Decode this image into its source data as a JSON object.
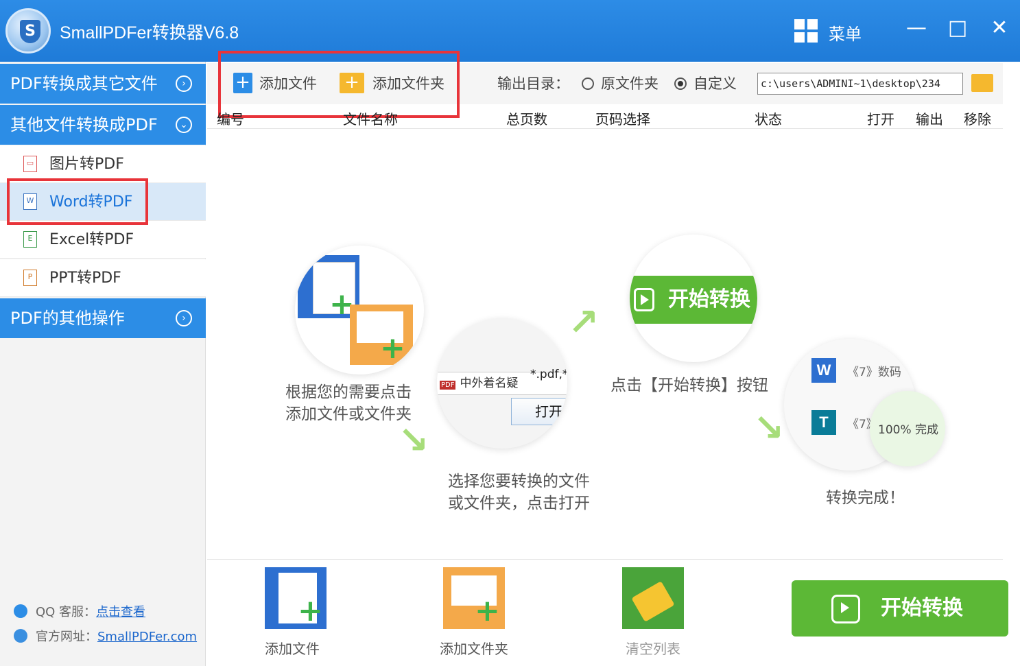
{
  "window": {
    "title": "SmallPDFer转换器V6.8",
    "menu_label": "菜单",
    "minimize": "—",
    "maximize": "□",
    "close": "✕"
  },
  "sidebar": {
    "sections": [
      {
        "label": "PDF转换成其它文件",
        "chevron": "›"
      },
      {
        "label": "其他文件转换成PDF",
        "chevron": "⌄"
      },
      {
        "label": "PDF的其他操作",
        "chevron": "›"
      }
    ],
    "items": [
      {
        "label": "图片转PDF",
        "icon": "image-icon"
      },
      {
        "label": "Word转PDF",
        "icon": "word-file-icon",
        "active": true
      },
      {
        "label": "Excel转PDF",
        "icon": "excel-file-icon"
      },
      {
        "label": "PPT转PDF",
        "icon": "ppt-file-icon"
      }
    ],
    "support": {
      "qq_label": "QQ 客服：",
      "qq_link": "点击查看",
      "site_label": "官方网址：",
      "site_link": "SmallPDFer.com"
    }
  },
  "toolbar": {
    "add_file": "添加文件",
    "add_folder": "添加文件夹",
    "output_label": "输出目录：",
    "radio_original": "原文件夹",
    "radio_custom": "自定义",
    "selected_output": "自定义",
    "output_path": "c:\\users\\ADMINI~1\\desktop\\234"
  },
  "table_headers": [
    "编号",
    "文件名称",
    "总页数",
    "页码选择",
    "状态",
    "打开",
    "输出",
    "移除"
  ],
  "guide": {
    "step1": [
      "根据您的需要点击",
      "添加文件或文件夹"
    ],
    "step2": [
      "选择您要转换的文件",
      "或文件夹，点击打开"
    ],
    "step2_file": "中外着名疑",
    "step2_filter": "*.pdf,*.",
    "step2_open": "打开",
    "step3": "点击【开始转换】按钮",
    "step3_button": "开始转换",
    "step4": "转换完成！",
    "step4_item1": "《7》数码",
    "step4_item2": "《7》",
    "step4_progress": "100%",
    "step4_status": "完成"
  },
  "bottom": {
    "add_file": "添加文件",
    "add_folder": "添加文件夹",
    "clear_list": "清空列表",
    "start": "开始转换"
  },
  "colors": {
    "brand_blue": "#2c8de6",
    "green": "#5cb836",
    "highlight_red": "#e8343a"
  }
}
